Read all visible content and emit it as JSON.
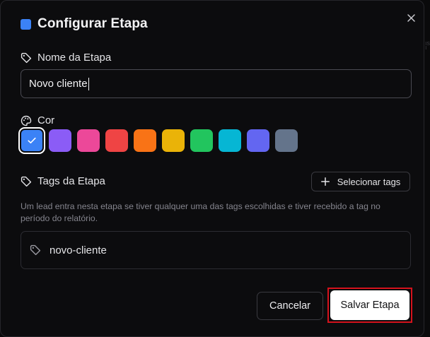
{
  "dialog": {
    "title": "Configurar Etapa",
    "accent_color": "#3b82f6"
  },
  "name_field": {
    "label": "Nome da Etapa",
    "value": "Novo cliente",
    "icon": "tag-icon"
  },
  "color_field": {
    "label": "Cor",
    "icon": "palette-icon",
    "selected_index": 0,
    "swatches": [
      {
        "name": "blue",
        "hex": "#3b82f6"
      },
      {
        "name": "violet",
        "hex": "#8b5cf6"
      },
      {
        "name": "pink",
        "hex": "#ec4899"
      },
      {
        "name": "red",
        "hex": "#ef4444"
      },
      {
        "name": "orange",
        "hex": "#f97316"
      },
      {
        "name": "yellow",
        "hex": "#eab308"
      },
      {
        "name": "green",
        "hex": "#22c55e"
      },
      {
        "name": "cyan",
        "hex": "#06b6d4"
      },
      {
        "name": "indigo",
        "hex": "#6366f1"
      },
      {
        "name": "slate",
        "hex": "#64748b"
      }
    ]
  },
  "tags_field": {
    "label": "Tags da Etapa",
    "icon": "tag-icon",
    "select_button_label": "Selecionar tags",
    "help_text": "Um lead entra nesta etapa se tiver qualquer uma das tags escolhidas e tiver recebido a tag no período do relatório.",
    "selected_tags": [
      "novo-cliente"
    ]
  },
  "actions": {
    "cancel_label": "Cancelar",
    "save_label": "Salvar Etapa"
  },
  "background_edge": {
    "glyph_1": "ıs",
    "glyph_2": "ı"
  }
}
